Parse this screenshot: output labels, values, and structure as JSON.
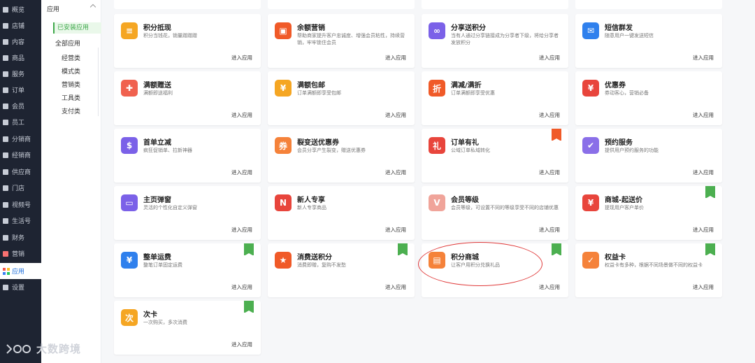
{
  "nav": {
    "items": [
      {
        "label": "概览",
        "icon": "monitor-icon"
      },
      {
        "label": "店铺",
        "icon": "store-icon"
      },
      {
        "label": "内容",
        "icon": "layers-icon"
      },
      {
        "label": "商品",
        "icon": "goods-icon"
      },
      {
        "label": "服务",
        "icon": "heart-icon"
      },
      {
        "label": "订单",
        "icon": "order-icon"
      },
      {
        "label": "会员",
        "icon": "member-icon"
      },
      {
        "label": "员工",
        "icon": "staff-icon"
      },
      {
        "label": "分销商",
        "icon": "distributor-icon"
      },
      {
        "label": "经销商",
        "icon": "dealer-icon"
      },
      {
        "label": "供应商",
        "icon": "supplier-icon"
      },
      {
        "label": "门店",
        "icon": "shop-icon"
      },
      {
        "label": "视频号",
        "icon": "video-icon"
      },
      {
        "label": "生活号",
        "icon": "life-icon"
      },
      {
        "label": "财务",
        "icon": "finance-icon"
      },
      {
        "label": "营销",
        "icon": "marketing-icon"
      },
      {
        "label": "应用",
        "icon": "apps-icon"
      },
      {
        "label": "设置",
        "icon": "settings-icon"
      }
    ],
    "active_index": 16
  },
  "subnav": {
    "heading": "应用",
    "installed": "已安装应用",
    "all": "全部应用",
    "children": [
      "经营类",
      "模式类",
      "营销类",
      "工具类",
      "支付类"
    ]
  },
  "enter_label": "进入应用",
  "cards": [
    {
      "title": "积分抵现",
      "desc": "积分当钱花，销量蹭蹭蹭",
      "icon": "coins-icon",
      "color": "#f5a623",
      "glyph": "≡"
    },
    {
      "title": "余额营销",
      "desc": "帮助商家提升客户忠诚度、增强会员粘性，持续营销，牢牢锁住会员",
      "icon": "wallet-icon",
      "color": "#f05a28",
      "glyph": "▣"
    },
    {
      "title": "分享送积分",
      "desc": "当有人通过分享链接成为分享者下级，将给分享者发放积分",
      "icon": "link-icon",
      "color": "#7b61e8",
      "glyph": "∞"
    },
    {
      "title": "短信群发",
      "desc": "随意用户一键发送短信",
      "icon": "sms-icon",
      "color": "#2f80ed",
      "glyph": "✉"
    },
    {
      "title": "满额赠送",
      "desc": "满额即送福利",
      "icon": "gift-icon",
      "color": "#f0614f",
      "glyph": "✚"
    },
    {
      "title": "满额包邮",
      "desc": "订单满额即享受包邮",
      "icon": "bag-icon",
      "color": "#f5a623",
      "glyph": "¥"
    },
    {
      "title": "满减/满折",
      "desc": "订单满额即享受优惠",
      "icon": "discount-icon",
      "color": "#f05a28",
      "glyph": "折"
    },
    {
      "title": "优惠券",
      "desc": "券动客心，营销必备",
      "icon": "coupon-icon",
      "color": "#e8453c",
      "glyph": "¥"
    },
    {
      "title": "首单立减",
      "desc": "疯狂促销单、拉新神器",
      "icon": "cart-icon",
      "color": "#7b61e8",
      "glyph": "$"
    },
    {
      "title": "裂变送优惠券",
      "desc": "会员分享产生裂变，赠送优惠券",
      "icon": "ticket-icon",
      "color": "#f5823a",
      "glyph": "券"
    },
    {
      "title": "订单有礼",
      "desc": "公域订单私域转化",
      "icon": "order-gift-icon",
      "color": "#e8453c",
      "glyph": "礼",
      "flag": "orange"
    },
    {
      "title": "预约服务",
      "desc": "提供用户预约服务的功能",
      "icon": "booking-icon",
      "color": "#8a6fe8",
      "glyph": "✔"
    },
    {
      "title": "主页弹窗",
      "desc": "灵活的个性化自定义弹窗",
      "icon": "popup-icon",
      "color": "#7b61e8",
      "glyph": "▭"
    },
    {
      "title": "新人专享",
      "desc": "新人专享商品",
      "icon": "new-icon",
      "color": "#e8453c",
      "glyph": "N"
    },
    {
      "title": "会员等级",
      "desc": "会员等级，可设置不同的等级享受不同的店铺优惠",
      "icon": "vip-icon",
      "color": "#f0a49a",
      "glyph": "V"
    },
    {
      "title": "商城-起送价",
      "desc": "提现用户客户单价",
      "icon": "min-price-icon",
      "color": "#e8453c",
      "glyph": "¥",
      "flag": "green"
    },
    {
      "title": "整单运费",
      "desc": "整笔订单固定运费",
      "icon": "truck-icon",
      "color": "#2f80ed",
      "glyph": "¥",
      "flag": "green"
    },
    {
      "title": "消费送积分",
      "desc": "消费即赠，复购不发愁",
      "icon": "basket-icon",
      "color": "#f05a28",
      "glyph": "★",
      "flag": "green"
    },
    {
      "title": "积分商城",
      "desc": "让客户用积分兑换礼品",
      "icon": "points-mall-icon",
      "color": "#f5823a",
      "glyph": "▤",
      "flag": "green"
    },
    {
      "title": "权益卡",
      "desc": "权益卡有多种，根据不同场景做不同的权益卡",
      "icon": "benefit-card-icon",
      "color": "#f5823a",
      "glyph": "✓",
      "flag": "green"
    },
    {
      "title": "次卡",
      "desc": "一次购买，多次消费",
      "icon": "times-card-icon",
      "color": "#f5a623",
      "glyph": "次",
      "flag": "green"
    }
  ],
  "watermark": "大数跨境"
}
